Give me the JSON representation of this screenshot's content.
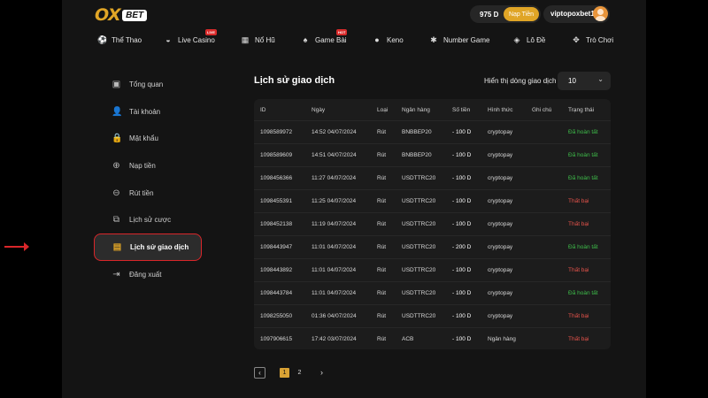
{
  "header": {
    "logo_ox": "OX",
    "logo_bet": "BET",
    "balance": "975 D",
    "deposit_label": "Nạp Tiền",
    "username": "viptopoxbet1"
  },
  "nav": {
    "items": [
      {
        "label": "Thể Thao",
        "icon": "soccer-ball-icon"
      },
      {
        "label": "Live Casino",
        "icon": "mask-icon",
        "badge": "LIVE"
      },
      {
        "label": "Nổ Hũ",
        "icon": "slot-icon"
      },
      {
        "label": "Game Bài",
        "icon": "spade-icon",
        "badge": "HOT"
      },
      {
        "label": "Keno",
        "icon": "keno-ball-icon"
      },
      {
        "label": "Number Game",
        "icon": "number-wheel-icon"
      },
      {
        "label": "Lô Đề",
        "icon": "lottery-icon"
      },
      {
        "label": "Trò Chơi",
        "icon": "gamepad-icon"
      }
    ]
  },
  "sidebar": {
    "items": [
      {
        "label": "Tổng quan",
        "icon": "wallet-icon"
      },
      {
        "label": "Tài khoản",
        "icon": "user-icon"
      },
      {
        "label": "Mật khẩu",
        "icon": "lock-icon"
      },
      {
        "label": "Nạp tiền",
        "icon": "deposit-icon"
      },
      {
        "label": "Rút tiền",
        "icon": "withdraw-icon"
      },
      {
        "label": "Lịch sử cược",
        "icon": "bet-history-icon"
      },
      {
        "label": "Lịch sử giao dịch",
        "icon": "transaction-history-icon",
        "active": true
      },
      {
        "label": "Đăng xuất",
        "icon": "logout-icon"
      }
    ]
  },
  "main": {
    "title": "Lịch sử giao dịch",
    "rows_label": "Hiển thị dòng giao dịch",
    "rows_value": "10",
    "columns": [
      "ID",
      "Ngày",
      "Loại",
      "Ngân hàng",
      "Số tiền",
      "Hình thức",
      "Ghi chú",
      "Trạng thái"
    ],
    "rows": [
      {
        "id": "1098589972",
        "date": "14:52 04/07/2024",
        "type": "Rút",
        "bank": "BNBBEP20",
        "amount": "- 100 D",
        "method": "cryptopay",
        "note": "",
        "status": "Đã hoàn tất",
        "ok": true
      },
      {
        "id": "1098589609",
        "date": "14:51 04/07/2024",
        "type": "Rút",
        "bank": "BNBBEP20",
        "amount": "- 100 D",
        "method": "cryptopay",
        "note": "",
        "status": "Đã hoàn tất",
        "ok": true
      },
      {
        "id": "1098456366",
        "date": "11:27 04/07/2024",
        "type": "Rút",
        "bank": "USDTTRC20",
        "amount": "- 100 D",
        "method": "cryptopay",
        "note": "",
        "status": "Đã hoàn tất",
        "ok": true
      },
      {
        "id": "1098455391",
        "date": "11:25 04/07/2024",
        "type": "Rút",
        "bank": "USDTTRC20",
        "amount": "- 100 D",
        "method": "cryptopay",
        "note": "",
        "status": "Thất bại",
        "ok": false
      },
      {
        "id": "1098452138",
        "date": "11:19 04/07/2024",
        "type": "Rút",
        "bank": "USDTTRC20",
        "amount": "- 100 D",
        "method": "cryptopay",
        "note": "",
        "status": "Thất bại",
        "ok": false
      },
      {
        "id": "1098443947",
        "date": "11:01 04/07/2024",
        "type": "Rút",
        "bank": "USDTTRC20",
        "amount": "- 200 D",
        "method": "cryptopay",
        "note": "",
        "status": "Đã hoàn tất",
        "ok": true
      },
      {
        "id": "1098443892",
        "date": "11:01 04/07/2024",
        "type": "Rút",
        "bank": "USDTTRC20",
        "amount": "- 100 D",
        "method": "cryptopay",
        "note": "",
        "status": "Thất bại",
        "ok": false
      },
      {
        "id": "1098443784",
        "date": "11:01 04/07/2024",
        "type": "Rút",
        "bank": "USDTTRC20",
        "amount": "- 100 D",
        "method": "cryptopay",
        "note": "",
        "status": "Đã hoàn tất",
        "ok": true
      },
      {
        "id": "1098255050",
        "date": "01:36 04/07/2024",
        "type": "Rút",
        "bank": "USDTTRC20",
        "amount": "- 100 D",
        "method": "cryptopay",
        "note": "",
        "status": "Thất bại",
        "ok": false
      },
      {
        "id": "1097906615",
        "date": "17:42 03/07/2024",
        "type": "Rút",
        "bank": "ACB",
        "amount": "- 100 D",
        "method": "Ngân hàng",
        "note": "",
        "status": "Thất bại",
        "ok": false
      }
    ]
  },
  "pagination": {
    "prev": "‹",
    "pages": [
      "1",
      "2"
    ],
    "next": "›"
  },
  "colors": {
    "accent": "#e0a526",
    "success": "#3ebd4a",
    "failure": "#e5534b",
    "highlight": "#d9262a"
  }
}
